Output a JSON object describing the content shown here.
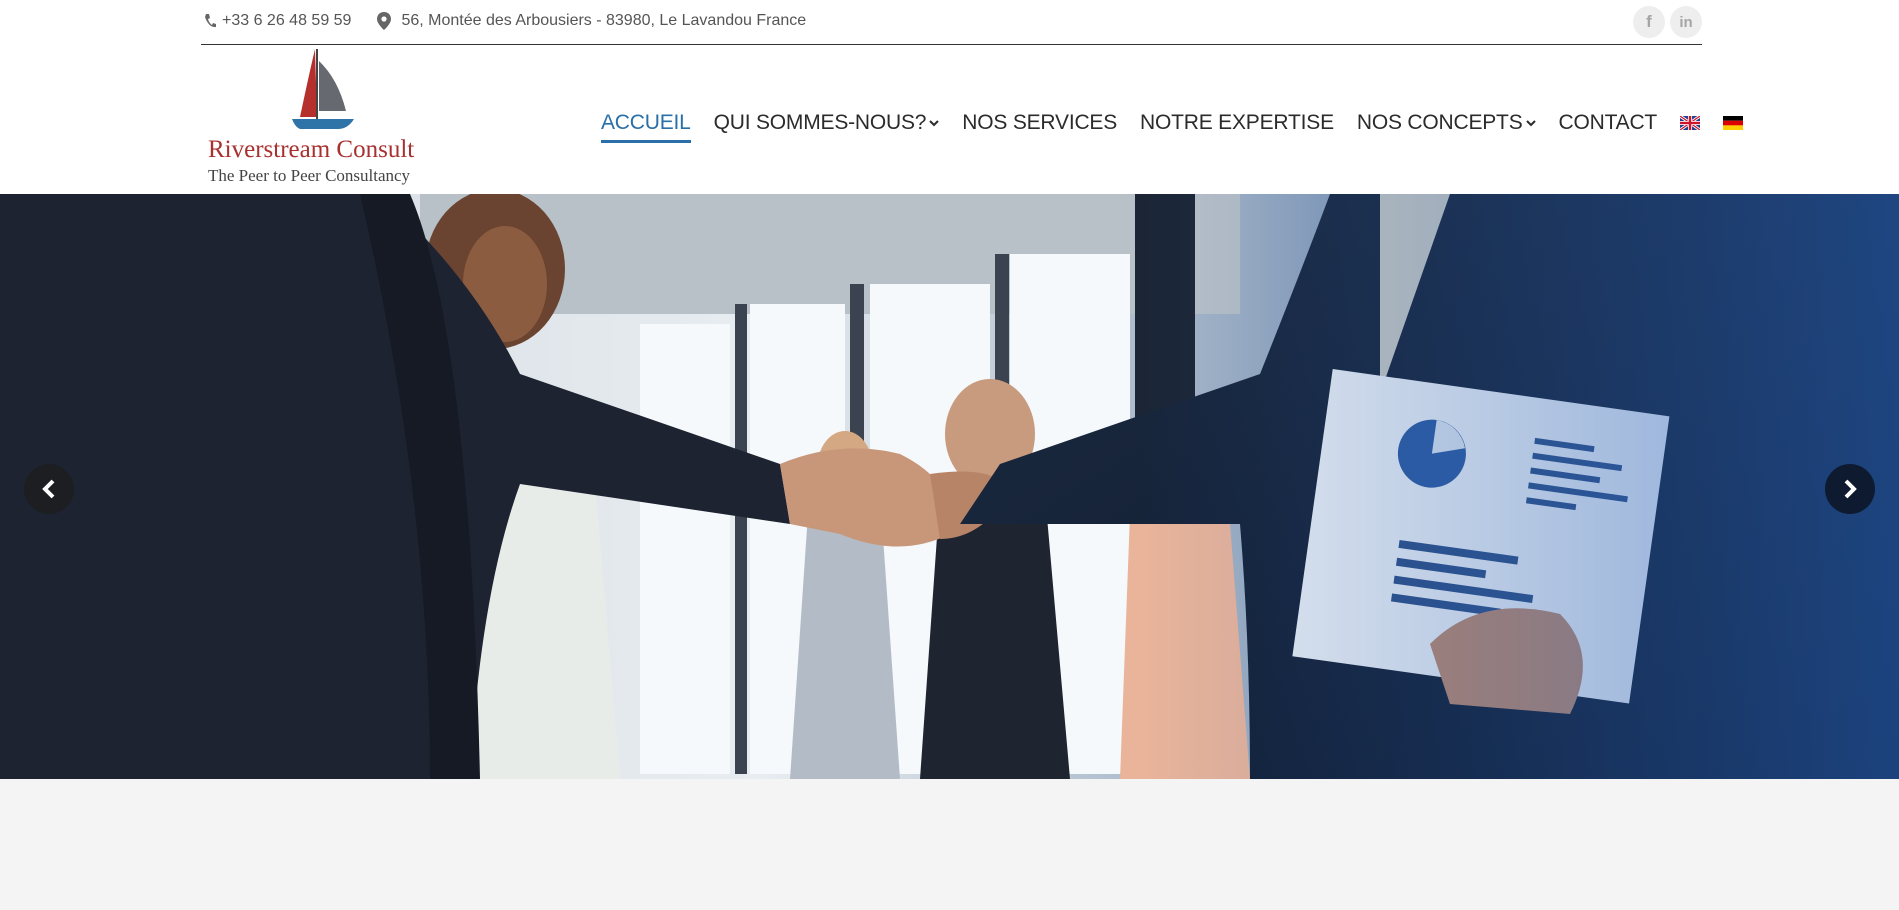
{
  "topbar": {
    "phone": "+33 6 26 48 59 59",
    "address": "56, Montée des Arbousiers - 83980, Le Lavandou France",
    "social": [
      {
        "label": "f",
        "icon": "facebook-icon"
      },
      {
        "label": "in",
        "icon": "linkedin-icon"
      }
    ]
  },
  "logo": {
    "brand": "Riverstream Consult",
    "tagline": "The Peer to Peer Consultancy"
  },
  "nav": {
    "items": [
      {
        "label": "ACCUEIL",
        "active": true
      },
      {
        "label": "QUI SOMMES-NOUS?",
        "dropdown": true
      },
      {
        "label": "NOS SERVICES"
      },
      {
        "label": "NOTRE EXPERTISE"
      },
      {
        "label": "NOS CONCEPTS",
        "dropdown": true
      },
      {
        "label": "CONTACT"
      }
    ],
    "languages": [
      "English",
      "Deutsch"
    ]
  },
  "colors": {
    "accent": "#2a6fa8",
    "brand_red": "#a8312f",
    "text": "#2b2b2b",
    "footer_band": "#f4f4f4"
  }
}
